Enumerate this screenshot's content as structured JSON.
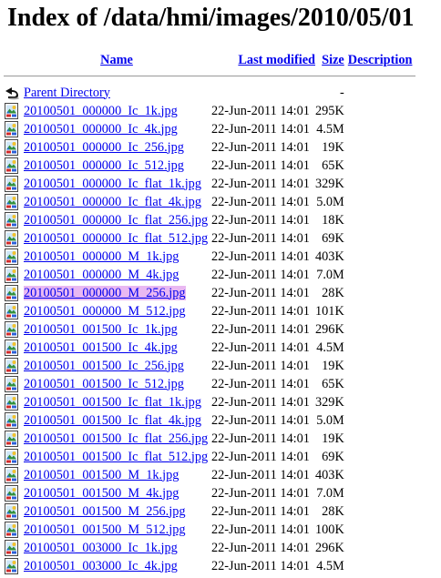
{
  "title": "Index of /data/hmi/images/2010/05/01",
  "columns": {
    "name": "Name",
    "last_modified": "Last modified",
    "size": "Size",
    "description": "Description"
  },
  "parent": {
    "name": "Parent Directory",
    "size": "-",
    "icon": "back-arrow-icon"
  },
  "file_icon": "image-file-icon",
  "selected_file": "20100501_000000_M_256.jpg",
  "files": [
    {
      "name": "20100501_000000_Ic_1k.jpg",
      "modified": "22-Jun-2011 14:01",
      "size": "295K"
    },
    {
      "name": "20100501_000000_Ic_4k.jpg",
      "modified": "22-Jun-2011 14:01",
      "size": "4.5M"
    },
    {
      "name": "20100501_000000_Ic_256.jpg",
      "modified": "22-Jun-2011 14:01",
      "size": "19K"
    },
    {
      "name": "20100501_000000_Ic_512.jpg",
      "modified": "22-Jun-2011 14:01",
      "size": "65K"
    },
    {
      "name": "20100501_000000_Ic_flat_1k.jpg",
      "modified": "22-Jun-2011 14:01",
      "size": "329K"
    },
    {
      "name": "20100501_000000_Ic_flat_4k.jpg",
      "modified": "22-Jun-2011 14:01",
      "size": "5.0M"
    },
    {
      "name": "20100501_000000_Ic_flat_256.jpg",
      "modified": "22-Jun-2011 14:01",
      "size": "18K"
    },
    {
      "name": "20100501_000000_Ic_flat_512.jpg",
      "modified": "22-Jun-2011 14:01",
      "size": "69K"
    },
    {
      "name": "20100501_000000_M_1k.jpg",
      "modified": "22-Jun-2011 14:01",
      "size": "403K"
    },
    {
      "name": "20100501_000000_M_4k.jpg",
      "modified": "22-Jun-2011 14:01",
      "size": "7.0M"
    },
    {
      "name": "20100501_000000_M_256.jpg",
      "modified": "22-Jun-2011 14:01",
      "size": "28K"
    },
    {
      "name": "20100501_000000_M_512.jpg",
      "modified": "22-Jun-2011 14:01",
      "size": "101K"
    },
    {
      "name": "20100501_001500_Ic_1k.jpg",
      "modified": "22-Jun-2011 14:01",
      "size": "296K"
    },
    {
      "name": "20100501_001500_Ic_4k.jpg",
      "modified": "22-Jun-2011 14:01",
      "size": "4.5M"
    },
    {
      "name": "20100501_001500_Ic_256.jpg",
      "modified": "22-Jun-2011 14:01",
      "size": "19K"
    },
    {
      "name": "20100501_001500_Ic_512.jpg",
      "modified": "22-Jun-2011 14:01",
      "size": "65K"
    },
    {
      "name": "20100501_001500_Ic_flat_1k.jpg",
      "modified": "22-Jun-2011 14:01",
      "size": "329K"
    },
    {
      "name": "20100501_001500_Ic_flat_4k.jpg",
      "modified": "22-Jun-2011 14:01",
      "size": "5.0M"
    },
    {
      "name": "20100501_001500_Ic_flat_256.jpg",
      "modified": "22-Jun-2011 14:01",
      "size": "19K"
    },
    {
      "name": "20100501_001500_Ic_flat_512.jpg",
      "modified": "22-Jun-2011 14:01",
      "size": "69K"
    },
    {
      "name": "20100501_001500_M_1k.jpg",
      "modified": "22-Jun-2011 14:01",
      "size": "403K"
    },
    {
      "name": "20100501_001500_M_4k.jpg",
      "modified": "22-Jun-2011 14:01",
      "size": "7.0M"
    },
    {
      "name": "20100501_001500_M_256.jpg",
      "modified": "22-Jun-2011 14:01",
      "size": "28K"
    },
    {
      "name": "20100501_001500_M_512.jpg",
      "modified": "22-Jun-2011 14:01",
      "size": "100K"
    },
    {
      "name": "20100501_003000_Ic_1k.jpg",
      "modified": "22-Jun-2011 14:01",
      "size": "296K"
    },
    {
      "name": "20100501_003000_Ic_4k.jpg",
      "modified": "22-Jun-2011 14:01",
      "size": "4.5M"
    }
  ],
  "colors": {
    "link": "#0000ee",
    "selected_highlight": "#e9b8f2",
    "rule": "#999999"
  }
}
